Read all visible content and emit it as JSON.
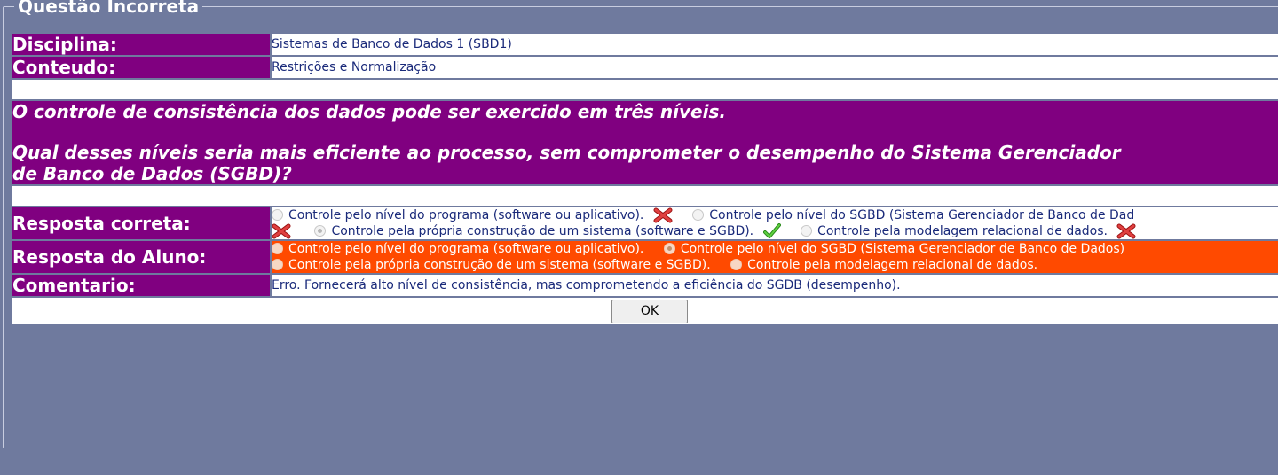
{
  "panel": {
    "title": "Questão Incorreta"
  },
  "disciplina": {
    "label": "Disciplina:",
    "value": "Sistemas de Banco de Dados 1 (SBD1)"
  },
  "conteudo": {
    "label": "Conteudo:",
    "value": "Restrições e Normalização"
  },
  "question": {
    "line1": "O controle de consistência dos dados pode ser exercido em três níveis.",
    "line2": "Qual desses níveis seria mais eficiente ao processo, sem comprometer o desempenho do Sistema Gerenciador",
    "line3": "de Banco de Dados (SGBD)?"
  },
  "resposta_correta": {
    "label": "Resposta correta:",
    "options": [
      {
        "text": "Controle pelo nível do programa (software ou aplicativo).",
        "mark": "x-icon",
        "checked": false
      },
      {
        "text": "Controle pelo nível do SGBD (Sistema Gerenciador de Banco de Dad",
        "mark": "x-icon",
        "checked": false
      },
      {
        "text": "Controle pela própria construção de um sistema (software e SGBD).",
        "mark": "check-icon",
        "checked": true
      },
      {
        "text": "Controle pela modelagem relacional de dados.",
        "mark": "x-icon",
        "checked": false
      }
    ]
  },
  "resposta_aluno": {
    "label": "Resposta do Aluno:",
    "options": [
      {
        "text": "Controle pelo nível do programa (software ou aplicativo).",
        "checked": false
      },
      {
        "text": "Controle pelo nível do SGBD (Sistema Gerenciador de Banco de Dados)",
        "checked": true
      },
      {
        "text": "Controle pela própria construção de um sistema (software e SGBD).",
        "checked": false
      },
      {
        "text": "Controle pela modelagem relacional de dados.",
        "checked": false
      }
    ]
  },
  "comentario": {
    "label": "Comentario:",
    "value": "Erro. Fornecerá alto nível de consistência, mas comprometendo a eficiência do SGDB (desempenho)."
  },
  "ok_button": {
    "label": "OK"
  },
  "colors": {
    "label_bg": "#800080",
    "student_bg": "#ff4a00",
    "page_bg": "#6f7a9e"
  }
}
